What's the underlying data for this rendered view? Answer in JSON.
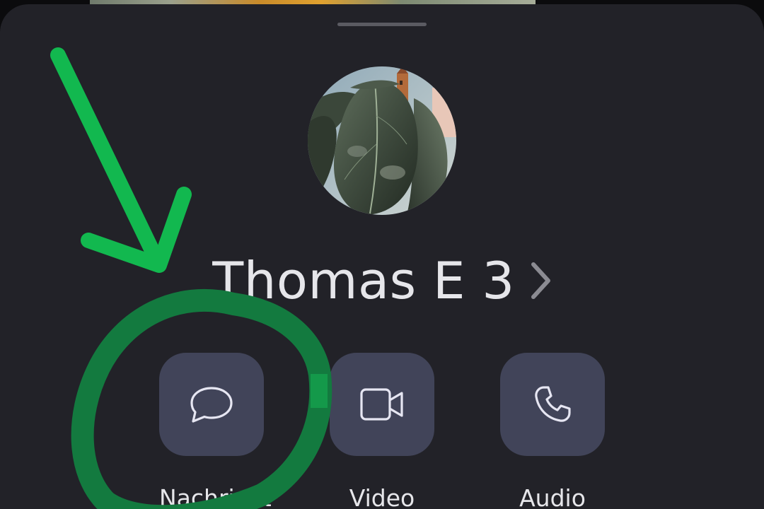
{
  "contact": {
    "name": "Thomas E 3"
  },
  "actions": [
    {
      "label": "Nachricht",
      "icon": "chat-bubble-icon"
    },
    {
      "label": "Video",
      "icon": "video-camera-icon"
    },
    {
      "label": "Audio",
      "icon": "phone-icon"
    }
  ],
  "icons": {
    "avatar": "plant-leaves-photo",
    "name_chevron": "chevron-right-icon"
  },
  "colors": {
    "sheet_background": "#222228",
    "button_background": "#414459",
    "text": "#e6e6ea",
    "annotation_arrow": "#12b84f",
    "annotation_circle": "#137a3f"
  }
}
